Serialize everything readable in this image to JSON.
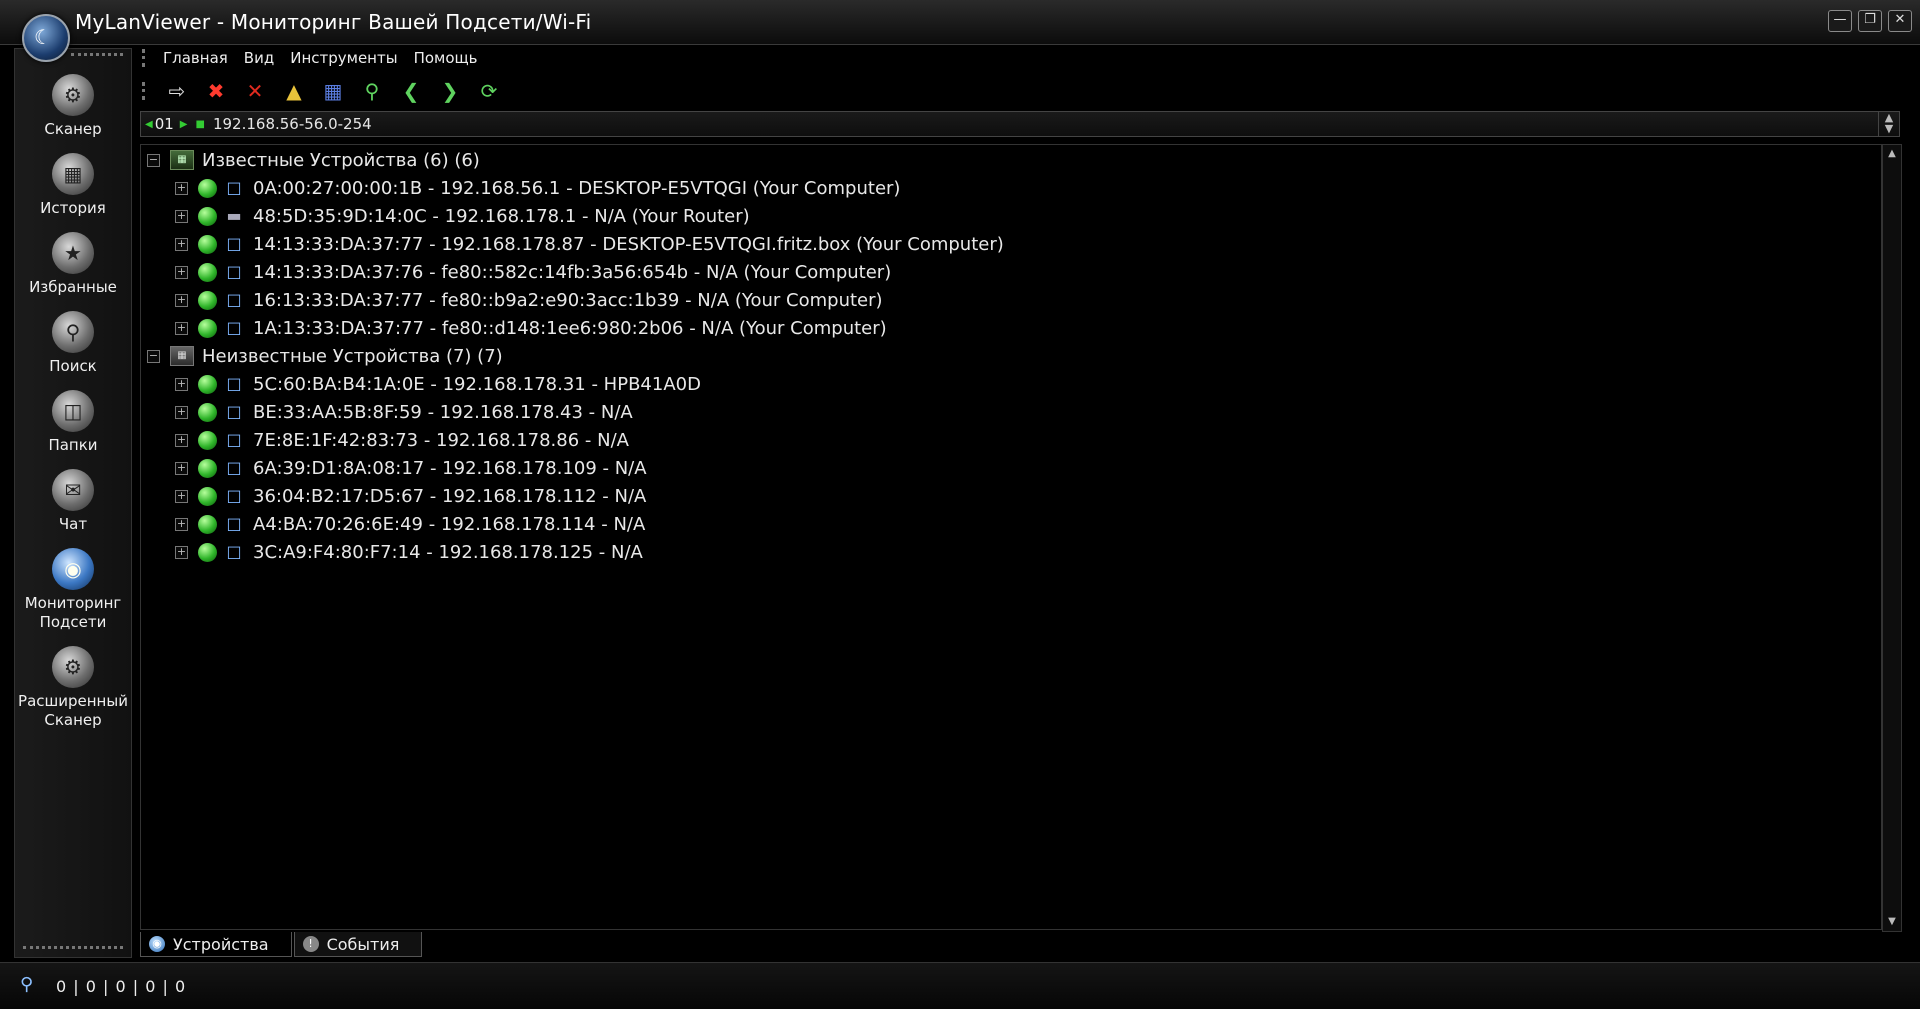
{
  "window": {
    "title": "MyLanViewer - Мониторинг Вашей Подсети/Wi-Fi",
    "controls": [
      "minimize",
      "restore",
      "close"
    ]
  },
  "sidebar": {
    "items": [
      {
        "label": "Сканер",
        "icon": "scanner-icon"
      },
      {
        "label": "История",
        "icon": "history-icon"
      },
      {
        "label": "Избранные",
        "icon": "favorites-icon"
      },
      {
        "label": "Поиск",
        "icon": "search-icon"
      },
      {
        "label": "Папки",
        "icon": "folders-icon"
      },
      {
        "label": "Чат",
        "icon": "chat-icon"
      },
      {
        "label": "Мониторинг Подсети",
        "icon": "subnet-monitoring-icon"
      },
      {
        "label": "Расширенный Сканер",
        "icon": "advanced-scanner-icon"
      }
    ]
  },
  "menu": [
    "Главная",
    "Вид",
    "Инструменты",
    "Помощь"
  ],
  "toolbar": {
    "buttons": [
      "export-icon",
      "stop-icon",
      "delete-icon",
      "open-folder-icon",
      "save-icon",
      "find-icon",
      "back-icon",
      "forward-icon",
      "refresh-icon"
    ]
  },
  "address_bar": {
    "index": "01",
    "range": "192.168.56-56.0-254"
  },
  "tree": {
    "groups": [
      {
        "label": "Известные Устройства (6) (6)",
        "devices": [
          {
            "text": "0A:00:27:00:00:1B - 192.168.56.1 - DESKTOP-E5VTQGI (Your Computer)",
            "type": "computer"
          },
          {
            "text": "48:5D:35:9D:14:0C - 192.168.178.1 - N/A (Your Router)",
            "type": "router"
          },
          {
            "text": "14:13:33:DA:37:77 - 192.168.178.87 - DESKTOP-E5VTQGI.fritz.box (Your Computer)",
            "type": "computer"
          },
          {
            "text": "14:13:33:DA:37:76 - fe80::582c:14fb:3a56:654b - N/A (Your Computer)",
            "type": "computer"
          },
          {
            "text": "16:13:33:DA:37:77 - fe80::b9a2:e90:3acc:1b39 - N/A (Your Computer)",
            "type": "computer"
          },
          {
            "text": "1A:13:33:DA:37:77 - fe80::d148:1ee6:980:2b06 - N/A (Your Computer)",
            "type": "computer"
          }
        ]
      },
      {
        "label": "Неизвестные Устройства (7) (7)",
        "devices": [
          {
            "text": "5C:60:BA:B4:1A:0E - 192.168.178.31 - HPB41A0D",
            "type": "computer"
          },
          {
            "text": "BE:33:AA:5B:8F:59 - 192.168.178.43 - N/A",
            "type": "computer"
          },
          {
            "text": "7E:8E:1F:42:83:73 - 192.168.178.86 - N/A",
            "type": "computer"
          },
          {
            "text": "6A:39:D1:8A:08:17 - 192.168.178.109 - N/A",
            "type": "computer"
          },
          {
            "text": "36:04:B2:17:D5:67 - 192.168.178.112 - N/A",
            "type": "computer"
          },
          {
            "text": "A4:BA:70:26:6E:49 - 192.168.178.114 - N/A",
            "type": "computer"
          },
          {
            "text": "3C:A9:F4:80:F7:14 - 192.168.178.125 - N/A",
            "type": "computer"
          }
        ]
      }
    ]
  },
  "tabs": [
    {
      "label": "Устройства",
      "icon": "devices-tab-icon",
      "active": true
    },
    {
      "label": "События",
      "icon": "events-tab-icon",
      "active": false
    }
  ],
  "status": {
    "counts": "0 | 0 | 0 | 0 | 0"
  }
}
